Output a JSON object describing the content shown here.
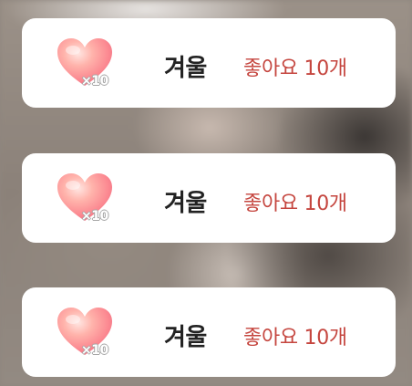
{
  "notifications": [
    {
      "icon": "heart-icon",
      "multiplier": "×10",
      "name": "겨울",
      "likes": "좋아요 10개"
    },
    {
      "icon": "heart-icon",
      "multiplier": "×10",
      "name": "겨울",
      "likes": "좋아요 10개"
    },
    {
      "icon": "heart-icon",
      "multiplier": "×10",
      "name": "겨울",
      "likes": "좋아요 10개"
    }
  ],
  "colors": {
    "card_background": "#ffffff",
    "name_text": "#222222",
    "likes_text": "#c5463f",
    "heart_light": "#ffd2cf",
    "heart_mid": "#fb8f93",
    "heart_dark": "#f26b7c"
  }
}
